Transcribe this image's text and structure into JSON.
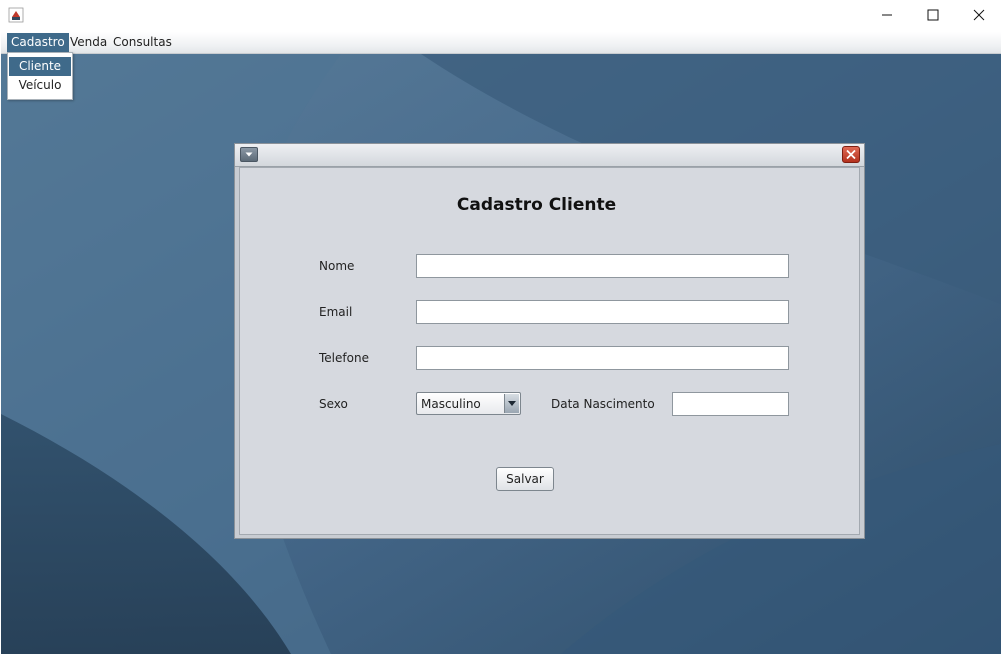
{
  "window": {
    "app_icon": "java-cup-icon",
    "controls": [
      "minimize-icon",
      "maximize-icon",
      "close-icon"
    ]
  },
  "menubar": {
    "items": [
      {
        "label": "Cadastro",
        "active": true
      },
      {
        "label": "Venda",
        "active": false
      },
      {
        "label": "Consultas",
        "active": false
      }
    ]
  },
  "dropdown": {
    "items": [
      {
        "label": "Cliente",
        "active": true
      },
      {
        "label": "Veículo",
        "active": false
      }
    ]
  },
  "form": {
    "title": "Cadastro Cliente",
    "labels": {
      "nome": "Nome",
      "email": "Email",
      "telefone": "Telefone",
      "sexo": "Sexo",
      "data_nascimento": "Data Nascimento"
    },
    "values": {
      "nome": "",
      "email": "",
      "telefone": "",
      "data_nascimento": ""
    },
    "sexo_selected": "Masculino",
    "save_label": "Salvar"
  },
  "colors": {
    "desktop": "#3e5f7c",
    "menu_highlight": "#3f6a8a",
    "close_button": "#c0392b"
  }
}
